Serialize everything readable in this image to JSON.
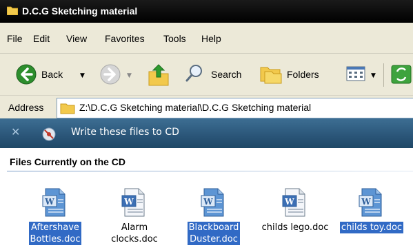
{
  "window": {
    "title": "D.C.G Sketching material"
  },
  "menu": {
    "items": [
      "File",
      "Edit",
      "View",
      "Favorites",
      "Tools",
      "Help"
    ]
  },
  "toolbar": {
    "back_label": "Back",
    "search_label": "Search",
    "folders_label": "Folders",
    "icons": [
      "back-arrow-icon",
      "forward-arrow-icon",
      "up-folder-icon",
      "search-icon",
      "folders-icon",
      "views-icon",
      "sync-icon"
    ]
  },
  "address": {
    "label": "Address",
    "value": "Z:\\D.C.G Sketching material\\D.C.G Sketching material"
  },
  "cd_task": {
    "label": "Write these files to CD"
  },
  "files_section": {
    "title": "Files Currently on the CD",
    "files": [
      {
        "line1": "Aftershave",
        "line2": "Bottles.doc",
        "selected": true
      },
      {
        "line1": "Alarm",
        "line2": "clocks.doc",
        "selected": false
      },
      {
        "line1": "Blackboard",
        "line2": "Duster.doc",
        "selected": true
      },
      {
        "line1": "childs lego.doc",
        "line2": "",
        "selected": false
      },
      {
        "line1": "childs toy.doc",
        "line2": "",
        "selected": true
      }
    ]
  },
  "colors": {
    "selection": "#316ac5",
    "banner": "#2a5578",
    "chrome": "#ece9d8"
  }
}
